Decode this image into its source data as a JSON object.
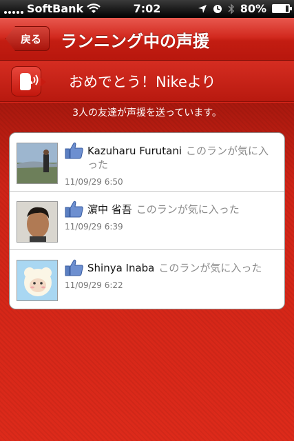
{
  "status_bar": {
    "carrier": "SoftBank",
    "time": "7:02",
    "battery": "80%",
    "battery_level": 0.8
  },
  "nav": {
    "back_label": "戻る",
    "title": "ランニング中の声援"
  },
  "cheer_banner": {
    "text": "おめでとう！Nikeより"
  },
  "info_text": "3人の友達が声援を送っています。",
  "entries": [
    {
      "name": "Kazuharu Furutani",
      "action": "このランが気に入った",
      "timestamp": "11/09/29 6:50"
    },
    {
      "name": "濵中 省吾",
      "action": "このランが気に入った",
      "timestamp": "11/09/29 6:39"
    },
    {
      "name": "Shinya Inaba",
      "action": "このランが気に入った",
      "timestamp": "11/09/29 6:22"
    }
  ],
  "colors": {
    "nav_red": "#d22a1f",
    "background_red": "#dd2a1a",
    "like_blue": "#5b7fc2"
  }
}
